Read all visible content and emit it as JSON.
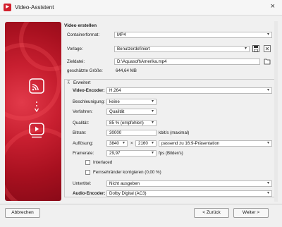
{
  "window": {
    "title": "Video-Assistent",
    "close_label": "×"
  },
  "content": {
    "section_title": "Video erstellen",
    "container": {
      "label": "Containerformat:",
      "value": "MP4"
    },
    "vorlage": {
      "label": "Vorlage:",
      "value": "Benutzerdefiniert"
    },
    "zieldatei": {
      "label": "Zieldatei:",
      "value": "D:\\Aquasoft\\Amerika.mp4"
    },
    "groesse": {
      "label": "geschätzte Größe:",
      "value": "644,64 MB"
    },
    "erweitert": {
      "toggle": "⊼",
      "label": "Erweitert"
    },
    "video_encoder": {
      "label": "Video-Encoder:",
      "value": "H.264"
    },
    "beschleunigung": {
      "label": "Beschleunigung:",
      "value": "keine"
    },
    "verfahren": {
      "label": "Verfahren:",
      "value": "Qualität"
    },
    "qualitaet": {
      "label": "Qualität:",
      "value": "85 % (empfohlen)"
    },
    "bitrate": {
      "label": "Bitrate:",
      "value": "30000",
      "unit": "kbit/s (maximal)"
    },
    "aufloesung": {
      "label": "Auflösung:",
      "width": "3840",
      "times": "×",
      "height": "2160",
      "preset": "passend zu 16:9-Präsentation"
    },
    "framerate": {
      "label": "Framerate:",
      "value": "29,97",
      "unit": "fps (Bilder/s)"
    },
    "interlaced": {
      "label": "Interlaced",
      "checked": false
    },
    "fernseh": {
      "label": "Fernsehränder korrigieren (0,00 %)",
      "checked": false
    },
    "untertitel": {
      "label": "Untertitel:",
      "value": "Nicht ausgeben"
    },
    "audio_encoder": {
      "label": "Audio-Encoder:",
      "value": "Dolby Digital (AC3)"
    }
  },
  "footer": {
    "cancel": "Abbrechen",
    "back": "< Zurück",
    "next": "Weiter >"
  },
  "colors": {
    "accent": "#c81f30"
  }
}
